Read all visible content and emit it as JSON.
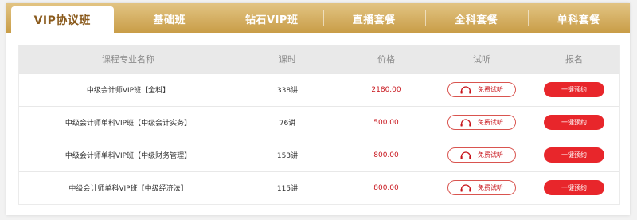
{
  "tabs": [
    {
      "label": "VIP协议班",
      "active": true
    },
    {
      "label": "基础班"
    },
    {
      "label": "钻石VIP班"
    },
    {
      "label": "直播套餐"
    },
    {
      "label": "全科套餐"
    },
    {
      "label": "单科套餐"
    }
  ],
  "table": {
    "headers": [
      "课程专业名称",
      "课时",
      "价格",
      "试听",
      "报名"
    ],
    "rows": [
      {
        "name": "中级会计师VIP班【全科】",
        "hours": "338讲",
        "price": "2180.00",
        "audit": "免费试听",
        "book": "一键预约"
      },
      {
        "name": "中级会计师单科VIP班【中级会计实务】",
        "hours": "76讲",
        "price": "500.00",
        "audit": "免费试听",
        "book": "一键预约"
      },
      {
        "name": "中级会计师单科VIP班【中级财务管理】",
        "hours": "153讲",
        "price": "800.00",
        "audit": "免费试听",
        "book": "一键预约"
      },
      {
        "name": "中级会计师单科VIP班【中级经济法】",
        "hours": "115讲",
        "price": "800.00",
        "audit": "免费试听",
        "book": "一键预约"
      }
    ]
  },
  "colors": {
    "gold": "#c89c46",
    "gold_light": "#e2c483",
    "brown": "#8a5a1c",
    "red": "#e8262b",
    "price_red": "#c8161d"
  },
  "icons": {
    "audit": "headphones-icon"
  }
}
